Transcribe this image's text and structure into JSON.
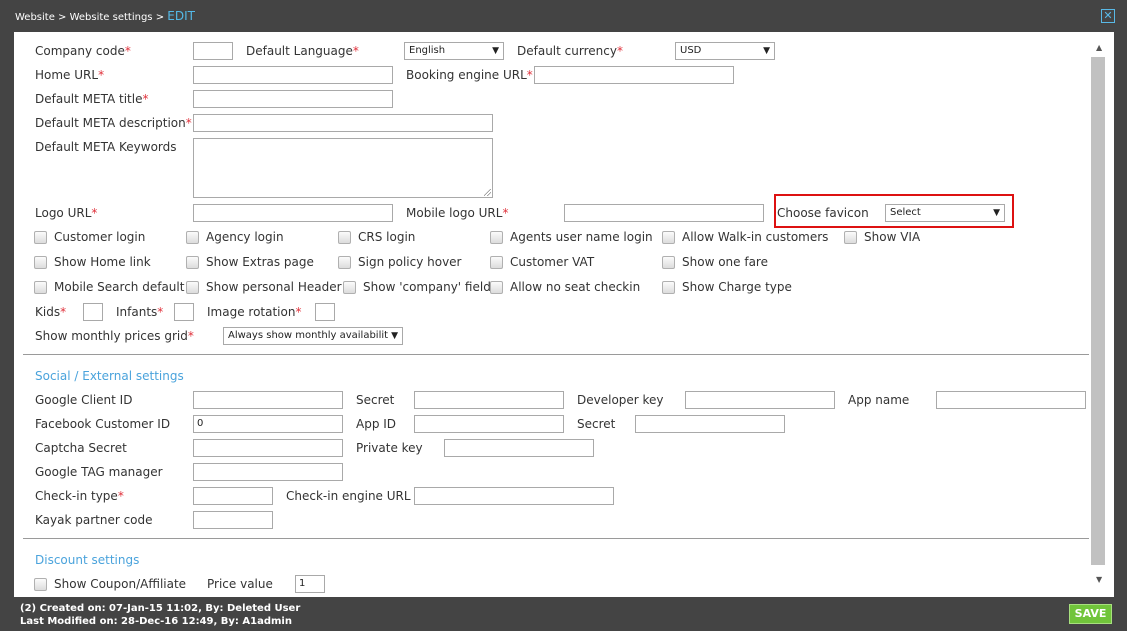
{
  "header": {
    "breadcrumb": "Website > Website settings > ",
    "breadcrumb_current": "EDIT",
    "close_icon": "close-icon"
  },
  "fields": {
    "company_code": {
      "label": "Company code",
      "value": ""
    },
    "default_language": {
      "label": "Default Language",
      "value": "English"
    },
    "default_currency": {
      "label": "Default currency",
      "value": "USD"
    },
    "home_url": {
      "label": "Home URL",
      "value": ""
    },
    "booking_engine_url": {
      "label": "Booking engine URL",
      "value": ""
    },
    "default_meta_title": {
      "label": "Default META title",
      "value": ""
    },
    "default_meta_description": {
      "label": "Default META description",
      "value": ""
    },
    "default_meta_keywords": {
      "label": "Default META Keywords",
      "value": ""
    },
    "logo_url": {
      "label": "Logo URL",
      "value": ""
    },
    "mobile_logo_url": {
      "label": "Mobile logo URL",
      "value": ""
    },
    "choose_favicon": {
      "label": "Choose favicon",
      "value": "Select"
    },
    "kids": {
      "label": "Kids",
      "value": ""
    },
    "infants": {
      "label": "Infants",
      "value": ""
    },
    "image_rotation": {
      "label": "Image rotation",
      "value": ""
    },
    "show_monthly_prices_grid": {
      "label": "Show monthly prices grid",
      "value": "Always show monthly availabilit"
    }
  },
  "required_mark": "*",
  "checkboxes": {
    "customer_login": "Customer login",
    "agency_login": "Agency login",
    "crs_login": "CRS login",
    "agents_user_name_login": "Agents user name login",
    "allow_walkin_customers": "Allow Walk-in customers",
    "show_via": "Show VIA",
    "show_home_link": "Show Home link",
    "show_extras_page": "Show Extras page",
    "sign_policy_hover": "Sign policy hover",
    "customer_vat": "Customer VAT",
    "show_one_fare": "Show one fare",
    "mobile_search_default": "Mobile Search default",
    "show_personal_header": "Show personal Header",
    "show_company_field": "Show 'company' field",
    "allow_no_seat_checkin": "Allow no seat checkin",
    "show_charge_type": "Show Charge type"
  },
  "social": {
    "title": "Social / External settings",
    "google_client_id": {
      "label": "Google Client ID",
      "value": ""
    },
    "google_secret": {
      "label": "Secret",
      "value": ""
    },
    "developer_key": {
      "label": "Developer key",
      "value": ""
    },
    "app_name": {
      "label": "App name",
      "value": ""
    },
    "facebook_customer_id": {
      "label": "Facebook Customer ID",
      "value": "0"
    },
    "app_id": {
      "label": "App ID",
      "value": ""
    },
    "facebook_secret": {
      "label": "Secret",
      "value": ""
    },
    "captcha_secret": {
      "label": "Captcha Secret",
      "value": ""
    },
    "private_key": {
      "label": "Private key",
      "value": ""
    },
    "google_tag_manager": {
      "label": "Google TAG manager",
      "value": ""
    },
    "checkin_type": {
      "label": "Check-in type",
      "value": ""
    },
    "checkin_engine_url": {
      "label": "Check-in engine URL",
      "value": ""
    },
    "kayak_partner_code": {
      "label": "Kayak partner code",
      "value": ""
    }
  },
  "discount": {
    "title": "Discount settings",
    "show_coupon_affiliate": "Show Coupon/Affiliate",
    "price_value": {
      "label": "Price value",
      "value": "1"
    }
  },
  "footer": {
    "created": "(2) Created on: 07-Jan-15 11:02, By: Deleted User",
    "modified": "Last Modified on: 28-Dec-16 12:49, By: A1admin",
    "save_label": "SAVE"
  },
  "icons": {
    "dropdown_arrow": "▼",
    "scroll_up": "▲",
    "scroll_down": "▼",
    "close": "✕"
  },
  "colors": {
    "accent": "#4aa3dc",
    "required": "#e0303a",
    "save": "#71c53b",
    "highlight": "#dd1111"
  }
}
